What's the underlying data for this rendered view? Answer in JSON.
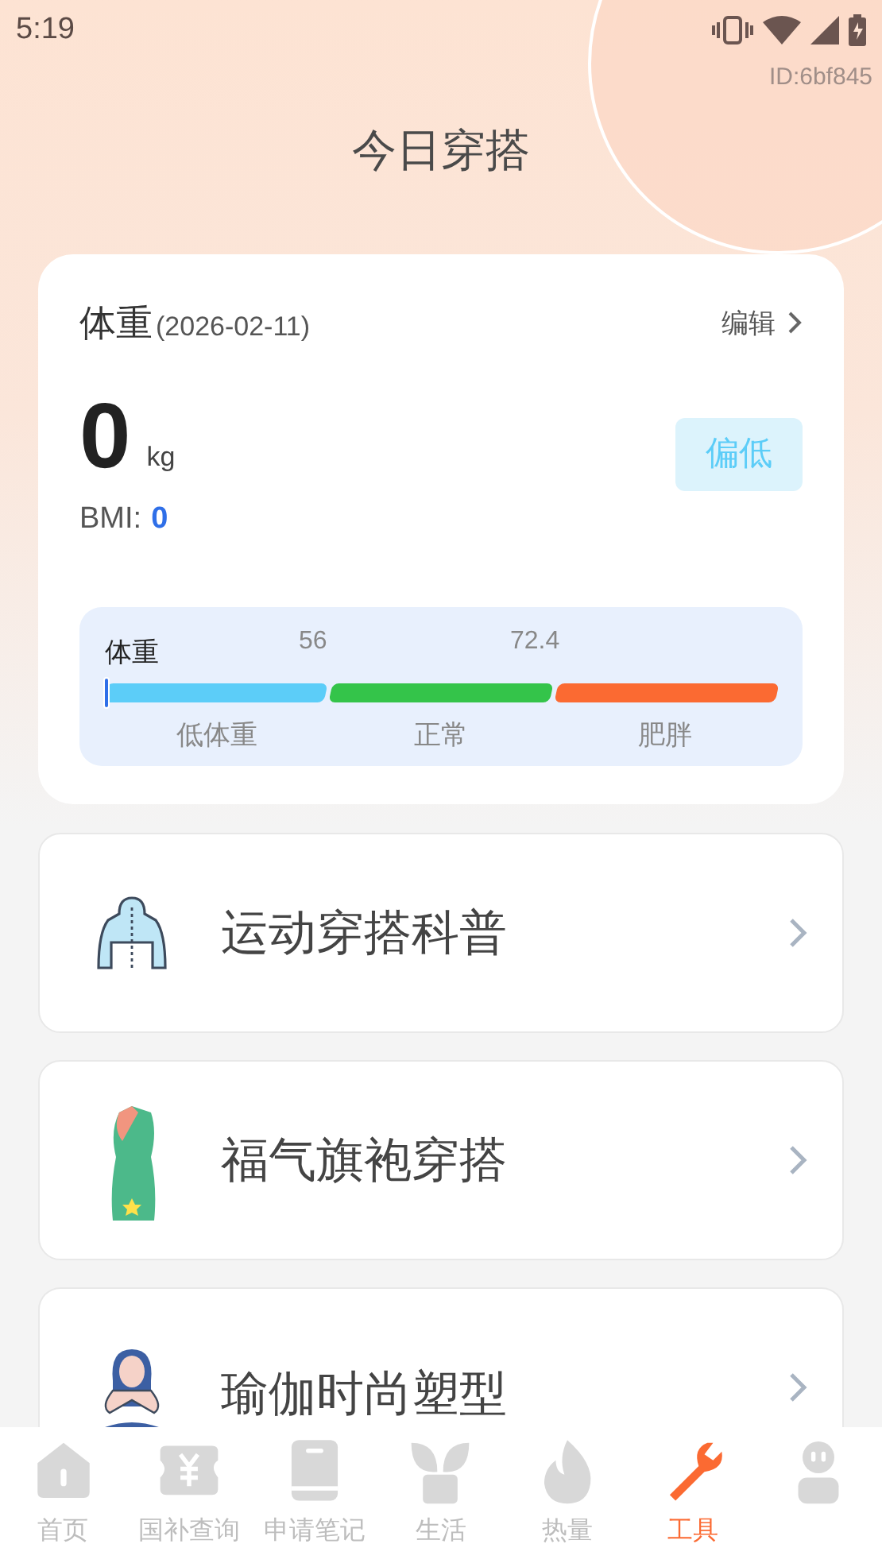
{
  "status_bar": {
    "time": "5:19"
  },
  "device_id": "ID:6bf845",
  "title": "今日穿搭",
  "weight_card": {
    "label": "体重",
    "date": "(2026-02-11)",
    "edit": "编辑",
    "value": "0",
    "unit": "kg",
    "bmi_label": "BMI:",
    "bmi_value": "0",
    "status_badge": "偏低",
    "scale": {
      "label": "体重",
      "level": 0,
      "thresholds": [
        "56",
        "72.4"
      ],
      "segments": [
        {
          "name": "低体重",
          "color": "#5ccdf8"
        },
        {
          "name": "正常",
          "color": "#34c44a"
        },
        {
          "name": "肥胖",
          "color": "#fb6a32"
        }
      ]
    }
  },
  "menu": [
    {
      "kind": "hoodie",
      "label": "运动穿搭科普"
    },
    {
      "kind": "qipao",
      "label": "福气旗袍穿搭"
    },
    {
      "kind": "yoga",
      "label": "瑜伽时尚塑型"
    }
  ],
  "tabs": [
    {
      "kind": "home",
      "label": "首页",
      "selected": false
    },
    {
      "kind": "ticket",
      "label": "国补查询",
      "selected": false
    },
    {
      "kind": "notebook",
      "label": "申请笔记",
      "selected": false
    },
    {
      "kind": "plant",
      "label": "生活",
      "selected": false
    },
    {
      "kind": "flame",
      "label": "热量",
      "selected": false
    },
    {
      "kind": "wrench",
      "label": "工具",
      "selected": true
    },
    {
      "kind": "robot",
      "selected": false
    }
  ]
}
